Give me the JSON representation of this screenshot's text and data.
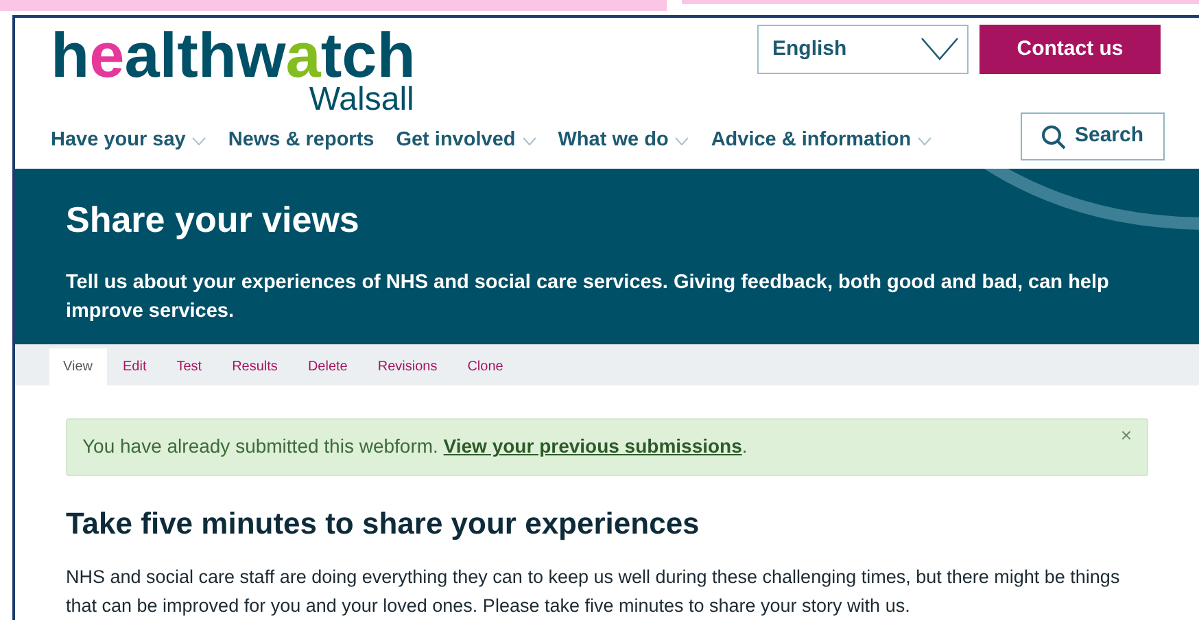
{
  "logo": {
    "parts": [
      {
        "text": "h",
        "color": "#005067"
      },
      {
        "text": "e",
        "color": "#e5399a"
      },
      {
        "text": "althw",
        "color": "#005067"
      },
      {
        "text": "a",
        "color": "#84bd1f"
      },
      {
        "text": "tch",
        "color": "#005067"
      }
    ],
    "subtitle": "Walsall"
  },
  "language": {
    "value": "English"
  },
  "contact_button": "Contact us",
  "nav": [
    {
      "label": "Have your say",
      "dropdown": true
    },
    {
      "label": "News & reports",
      "dropdown": false
    },
    {
      "label": "Get involved",
      "dropdown": true
    },
    {
      "label": "What we do",
      "dropdown": true
    },
    {
      "label": "Advice & information",
      "dropdown": true
    }
  ],
  "search_button": "Search",
  "banner": {
    "title": "Share your views",
    "text": "Tell us about your experiences of NHS and social care services. Giving feedback, both good and bad, can help improve services."
  },
  "tabs": [
    {
      "label": "View",
      "selected": true
    },
    {
      "label": "Edit",
      "selected": false
    },
    {
      "label": "Test",
      "selected": false
    },
    {
      "label": "Results",
      "selected": false
    },
    {
      "label": "Delete",
      "selected": false
    },
    {
      "label": "Revisions",
      "selected": false
    },
    {
      "label": "Clone",
      "selected": false
    }
  ],
  "alert": {
    "text": "You have already submitted this webform.",
    "link": "View your previous submissions",
    "after": ".",
    "close": "×"
  },
  "heading": "Take five minutes to share your experiences",
  "paragraph": "NHS and social care staff are doing everything they can to keep us well during these challenging times, but there might be things that can be improved for you and your loved ones. Please take five minutes to share your story with us."
}
